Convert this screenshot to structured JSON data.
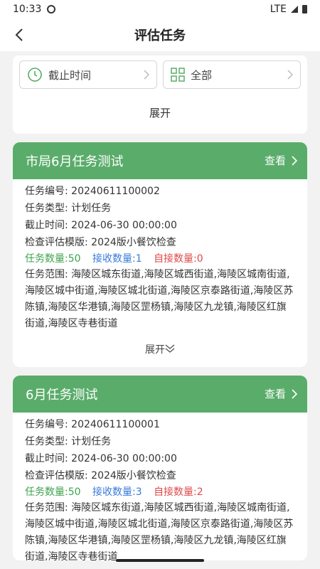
{
  "status": {
    "time": "10:33",
    "network": "LTE"
  },
  "nav": {
    "title": "评估任务"
  },
  "filters": {
    "deadline_label": "截止时间",
    "category_label": "全部",
    "expand_label": "展开"
  },
  "tasks": [
    {
      "title": "市局6月任务测试",
      "view_label": "查看",
      "number_key": "任务编号:",
      "number": "20240611100002",
      "type_key": "任务类型:",
      "type": "计划任务",
      "deadline_key": "截止时间:",
      "deadline": "2024-06-30 00:00:00",
      "template_key": "检查评估模版:",
      "template": "2024版小餐饮检查",
      "count_total": "任务数量:50",
      "count_received": "接收数量:1",
      "count_auto": "自接数量:0",
      "scope": "任务范围: 海陵区城东街道,海陵区城西街道,海陵区城南街道,海陵区城中街道,海陵区城北街道,海陵区京泰路街道,海陵区苏陈镇,海陵区华港镇,海陵区罡杨镇,海陵区九龙镇,海陵区红旗街道,海陵区寺巷街道",
      "expand_label": "展开"
    },
    {
      "title": "6月任务测试",
      "view_label": "查看",
      "number_key": "任务编号:",
      "number": "20240611100001",
      "type_key": "任务类型:",
      "type": "计划任务",
      "deadline_key": "截止时间:",
      "deadline": "2024-06-30 00:00:00",
      "template_key": "检查评估模版:",
      "template": "2024版小餐饮检查",
      "count_total": "任务数量:50",
      "count_received": "接收数量:3",
      "count_auto": "自接数量:2",
      "scope": "任务范围: 海陵区城东街道,海陵区城西街道,海陵区城南街道,海陵区城中街道,海陵区城北街道,海陵区京泰路街道,海陵区苏陈镇,海陵区华港镇,海陵区罡杨镇,海陵区九龙镇,海陵区红旗街道,海陵区寺巷街道"
    }
  ],
  "colors": {
    "header_green": "#5aac6a",
    "count_green": "#3ea34e",
    "count_blue": "#3a7ad9",
    "count_red": "#e04a4a"
  }
}
